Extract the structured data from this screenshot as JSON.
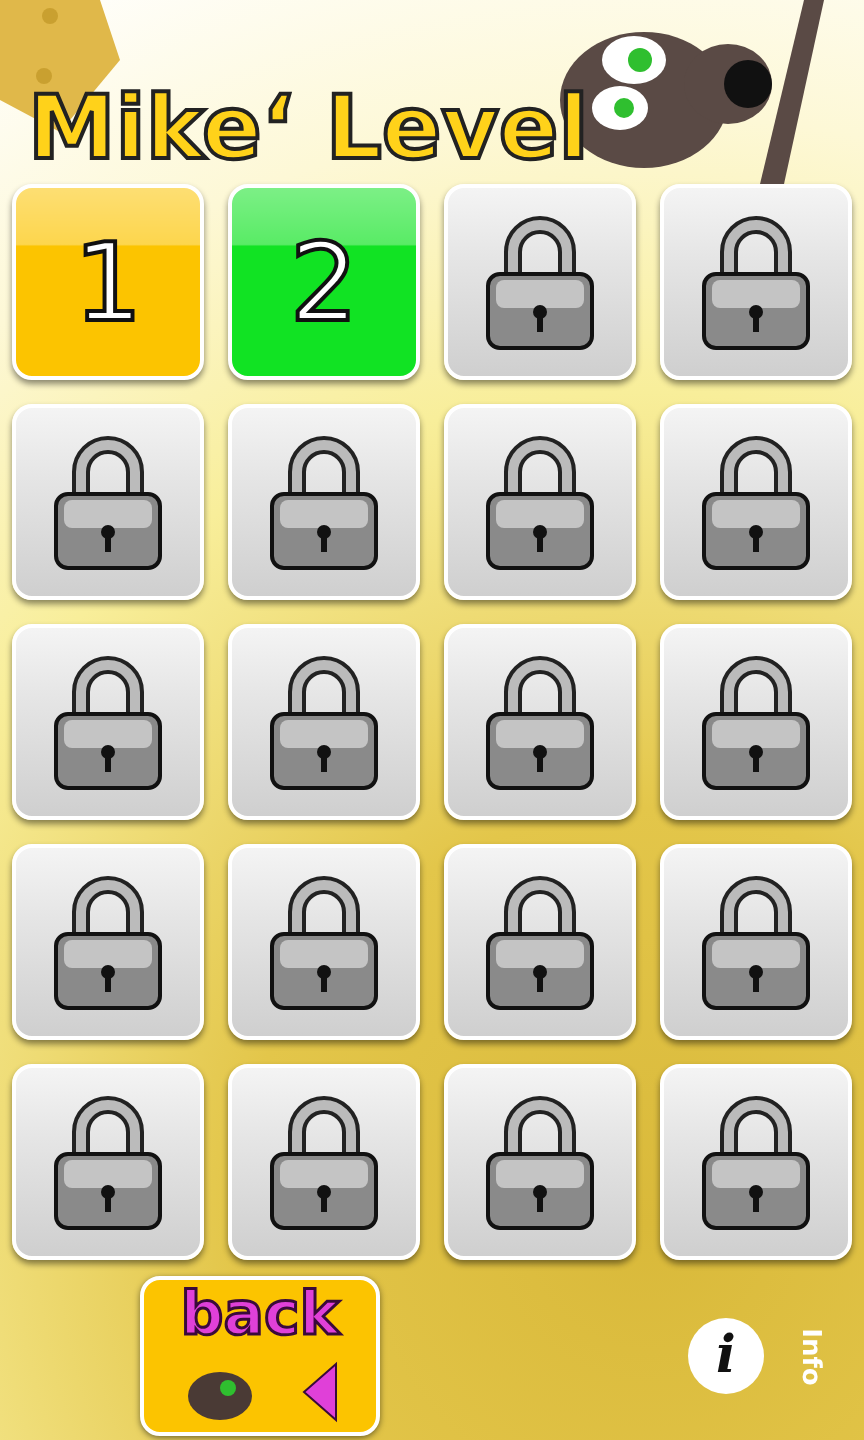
{
  "title": "Mike‘ Level",
  "levels": [
    {
      "kind": "open",
      "label": "1",
      "color": "#fcc400"
    },
    {
      "kind": "open",
      "label": "2",
      "color": "#11e323"
    },
    {
      "kind": "locked"
    },
    {
      "kind": "locked"
    },
    {
      "kind": "locked"
    },
    {
      "kind": "locked"
    },
    {
      "kind": "locked"
    },
    {
      "kind": "locked"
    },
    {
      "kind": "locked"
    },
    {
      "kind": "locked"
    },
    {
      "kind": "locked"
    },
    {
      "kind": "locked"
    },
    {
      "kind": "locked"
    },
    {
      "kind": "locked"
    },
    {
      "kind": "locked"
    },
    {
      "kind": "locked"
    },
    {
      "kind": "locked"
    },
    {
      "kind": "locked"
    },
    {
      "kind": "locked"
    },
    {
      "kind": "locked"
    }
  ],
  "back_button": {
    "label": "back"
  },
  "info": {
    "icon_label": "i",
    "label": "Info"
  }
}
